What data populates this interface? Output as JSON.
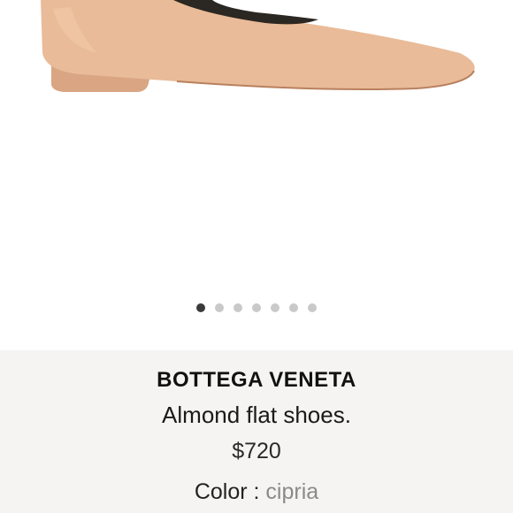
{
  "product": {
    "brand": "BOTTEGA VENETA",
    "name": "Almond flat shoes.",
    "price": "$720",
    "color_label": "Color : ",
    "color_value": "cipria"
  },
  "gallery": {
    "image_icon": "shoe-image",
    "image_count": 7,
    "active_index": 0,
    "shoe_color": "#e8b996",
    "sole_color": "#c89170",
    "lining_color": "#2a2620"
  },
  "colors": {
    "info_bg": "#f5f4f2",
    "dot_active": "#3a3a3a",
    "dot_inactive": "#c9c9c9"
  }
}
